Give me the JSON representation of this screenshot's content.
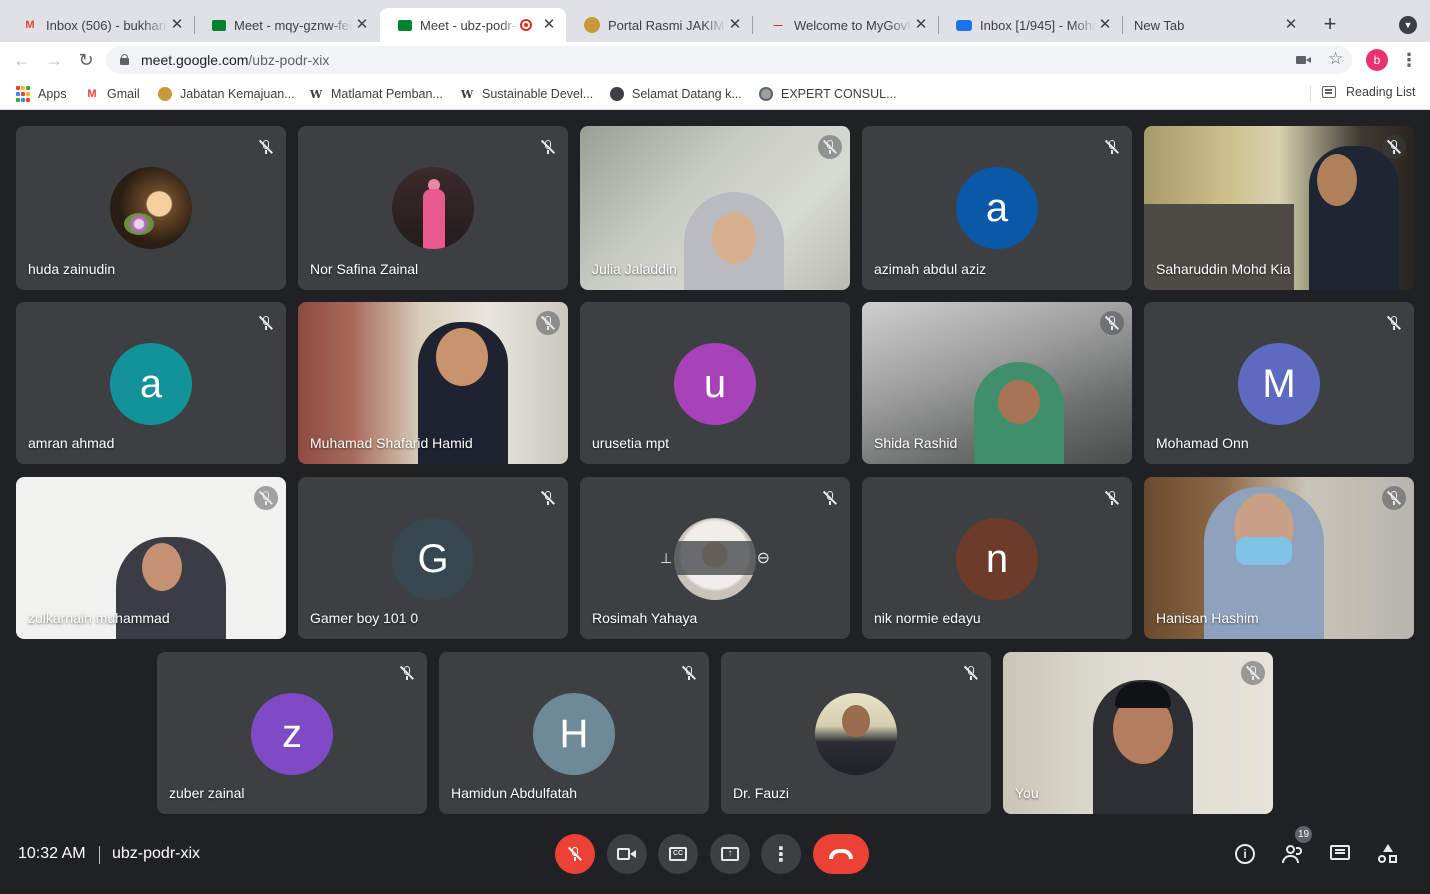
{
  "browser": {
    "tabs": [
      {
        "title": "Inbox (506) - bukhari",
        "icon": "gmail-icon",
        "active": false
      },
      {
        "title": "Meet - mqy-gznw-fec",
        "icon": "meet-icon",
        "active": false
      },
      {
        "title": "Meet - ubz-podr-",
        "icon": "meet-icon",
        "active": true,
        "recording": true
      },
      {
        "title": "Portal Rasmi JAKIM -",
        "icon": "jakim-logo-icon",
        "active": false
      },
      {
        "title": "Welcome to MyGovUC",
        "icon": "mygovuc-icon",
        "active": false
      },
      {
        "title": "Inbox [1/945] - Mohd",
        "icon": "mail-icon",
        "active": false
      },
      {
        "title": "New Tab",
        "icon": "",
        "active": false
      }
    ],
    "new_tab_label": "+",
    "url_host": "meet.google.com",
    "url_path": "/ubz-podr-xix",
    "profile_initial": "b",
    "bookmarks": [
      {
        "label": "Apps",
        "icon": "apps-grid-icon"
      },
      {
        "label": "Gmail",
        "icon": "gmail-icon"
      },
      {
        "label": "Jabatan Kemajuan...",
        "icon": "jakim-logo-icon"
      },
      {
        "label": "Matlamat Pemban...",
        "icon": "wordpress-icon"
      },
      {
        "label": "Sustainable Devel...",
        "icon": "wordpress-icon"
      },
      {
        "label": "Selamat Datang k...",
        "icon": "globe-icon"
      },
      {
        "label": "EXPERT CONSUL...",
        "icon": "seal-icon"
      }
    ],
    "reading_list_label": "Reading List"
  },
  "meet": {
    "participants": [
      {
        "name": "huda zainudin",
        "kind": "photo",
        "muted": true
      },
      {
        "name": "Nor Safina Zainal",
        "kind": "photo",
        "muted": true
      },
      {
        "name": "Julia Jaladdin",
        "kind": "video",
        "muted": true
      },
      {
        "name": "azimah abdul aziz",
        "kind": "letter",
        "letter": "a",
        "color": "#0b57a8",
        "muted": true
      },
      {
        "name": "Saharuddin Mohd Kia",
        "kind": "video",
        "muted": true
      },
      {
        "name": "amran ahmad",
        "kind": "letter",
        "letter": "a",
        "color": "#12939a",
        "muted": true
      },
      {
        "name": "Muhamad Shafarid Hamid",
        "kind": "video",
        "muted": true
      },
      {
        "name": "urusetia mpt",
        "kind": "letter",
        "letter": "u",
        "color": "#a842b8",
        "muted": false
      },
      {
        "name": "Shida Rashid",
        "kind": "video",
        "muted": true
      },
      {
        "name": "Mohamad Onn",
        "kind": "letter",
        "letter": "M",
        "color": "#5c6bc0",
        "muted": true
      },
      {
        "name": "zulkarnain muhammad",
        "kind": "video",
        "muted": true
      },
      {
        "name": "Gamer boy 101 0",
        "kind": "letter",
        "letter": "G",
        "color": "#37474f",
        "muted": true
      },
      {
        "name": "Rosimah Yahaya",
        "kind": "photo",
        "muted": true
      },
      {
        "name": "nik normie edayu",
        "kind": "letter",
        "letter": "n",
        "color": "#6d3b2a",
        "muted": true
      },
      {
        "name": "Hanisan Hashim",
        "kind": "video",
        "muted": true
      },
      {
        "name": "zuber zainal",
        "kind": "letter",
        "letter": "z",
        "color": "#7e4bc4",
        "muted": true
      },
      {
        "name": "Hamidun Abdulfatah",
        "kind": "letter",
        "letter": "H",
        "color": "#6e8a99",
        "muted": true
      },
      {
        "name": "Dr. Fauzi",
        "kind": "photo",
        "muted": true
      },
      {
        "name": "You",
        "kind": "video",
        "muted": true
      }
    ],
    "clock": "10:32 AM",
    "meeting_code": "ubz-podr-xix",
    "participant_count": "19",
    "colors": {
      "danger": "#ea4335",
      "tile_bg": "#3c4043",
      "page_bg": "#202124"
    }
  }
}
